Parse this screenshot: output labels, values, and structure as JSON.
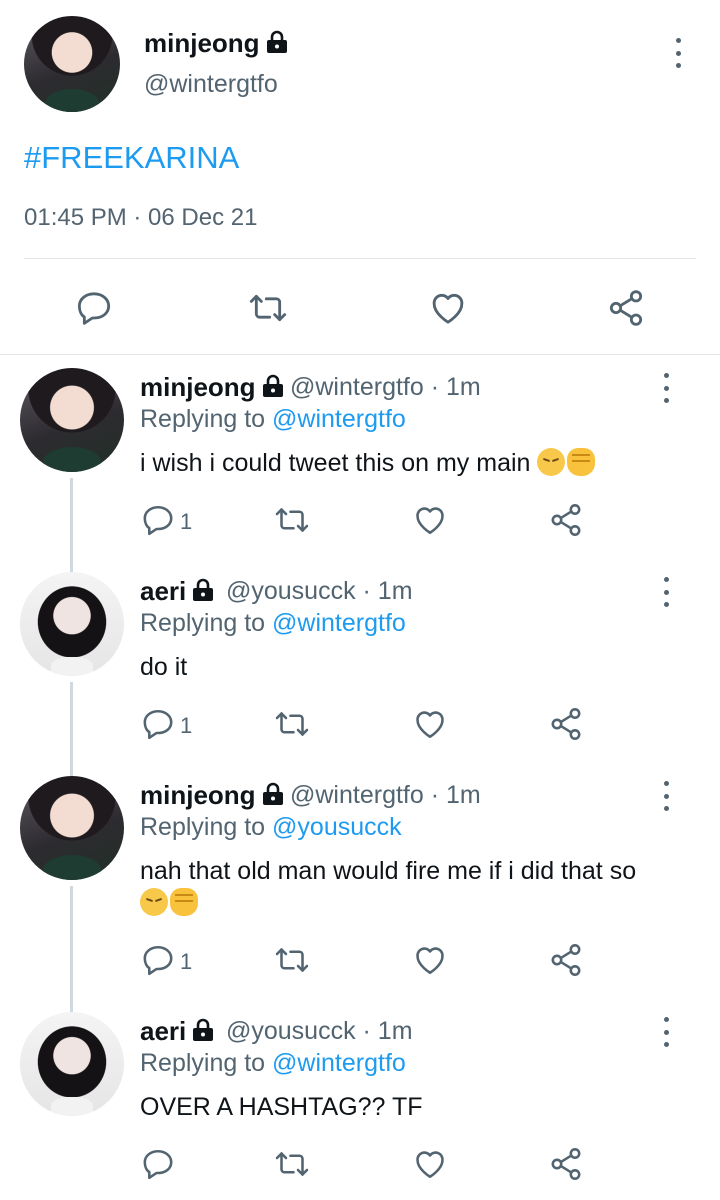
{
  "main_tweet": {
    "name": "minjeong",
    "handle": "@wintergtfo",
    "text": "#FREEKARINA",
    "timestamp": "01:45 PM · 06 Dec 21"
  },
  "replies": [
    {
      "name": "minjeong",
      "handle": "@wintergtfo · 1m",
      "replying_prefix": "Replying to ",
      "replying_to": "@wintergtfo",
      "text": "i wish i could tweet this on my main",
      "text_line2": "",
      "reply_count": "1"
    },
    {
      "name": "aeri",
      "handle": "@yousucck · 1m",
      "replying_prefix": "Replying to ",
      "replying_to": "@wintergtfo",
      "text": "do it",
      "text_line2": "",
      "reply_count": "1"
    },
    {
      "name": "minjeong",
      "handle": "@wintergtfo · 1m",
      "replying_prefix": "Replying to ",
      "replying_to": "@yousucck",
      "text": "nah that old man would fire me if i did that so",
      "text_line2": "",
      "reply_count": "1"
    },
    {
      "name": "aeri",
      "handle": "@yousucck · 1m",
      "replying_prefix": "Replying to ",
      "replying_to": "@wintergtfo",
      "text": "OVER A HASHTAG?? TF",
      "text_line2": "",
      "reply_count": ""
    }
  ],
  "icons": {
    "reply": "reply-icon",
    "retweet": "retweet-icon",
    "like": "heart-icon",
    "share": "share-icon",
    "more": "more-vertical-icon",
    "lock": "lock-icon"
  },
  "colors": {
    "accent": "#1d9bf0",
    "muted": "#536471",
    "text": "#0f1419",
    "divider": "#e1e6ea"
  }
}
